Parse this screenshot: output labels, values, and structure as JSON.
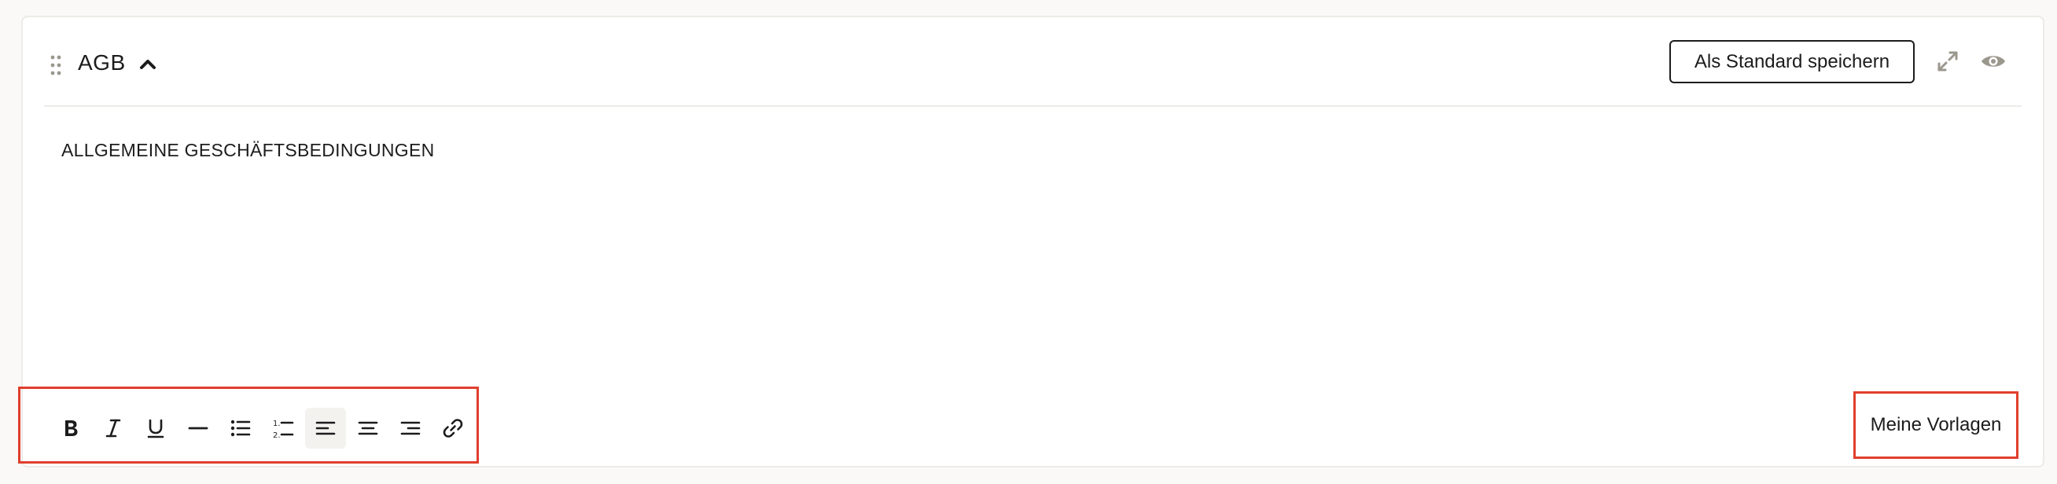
{
  "block": {
    "title": "AGB",
    "save_default_label": "Als Standard speichern",
    "content_text": "ALLGEMEINE GESCHÄFTSBEDINGUNGEN",
    "templates_label": "Meine Vorlagen"
  },
  "icons": {
    "drag": "drag-handle-icon",
    "collapse": "chevron-up-icon",
    "expand": "expand-arrows-icon",
    "preview": "eye-icon"
  },
  "toolbar": {
    "buttons": [
      {
        "name": "bold",
        "icon": "bold-icon"
      },
      {
        "name": "italic",
        "icon": "italic-icon"
      },
      {
        "name": "underline",
        "icon": "underline-icon"
      },
      {
        "name": "horizontal-rule",
        "icon": "horizontal-rule-icon"
      },
      {
        "name": "bullet-list",
        "icon": "bullet-list-icon"
      },
      {
        "name": "numbered-list",
        "icon": "numbered-list-icon"
      },
      {
        "name": "align-left",
        "icon": "align-left-icon",
        "active": true
      },
      {
        "name": "align-center",
        "icon": "align-center-icon"
      },
      {
        "name": "align-right",
        "icon": "align-right-icon"
      },
      {
        "name": "link",
        "icon": "link-icon"
      }
    ]
  },
  "colors": {
    "highlight_border": "#e03e2d",
    "icon_muted": "#9a978d",
    "text": "#1c1c1c",
    "card_border": "#ecebe8",
    "page_bg": "#faf9f7"
  }
}
